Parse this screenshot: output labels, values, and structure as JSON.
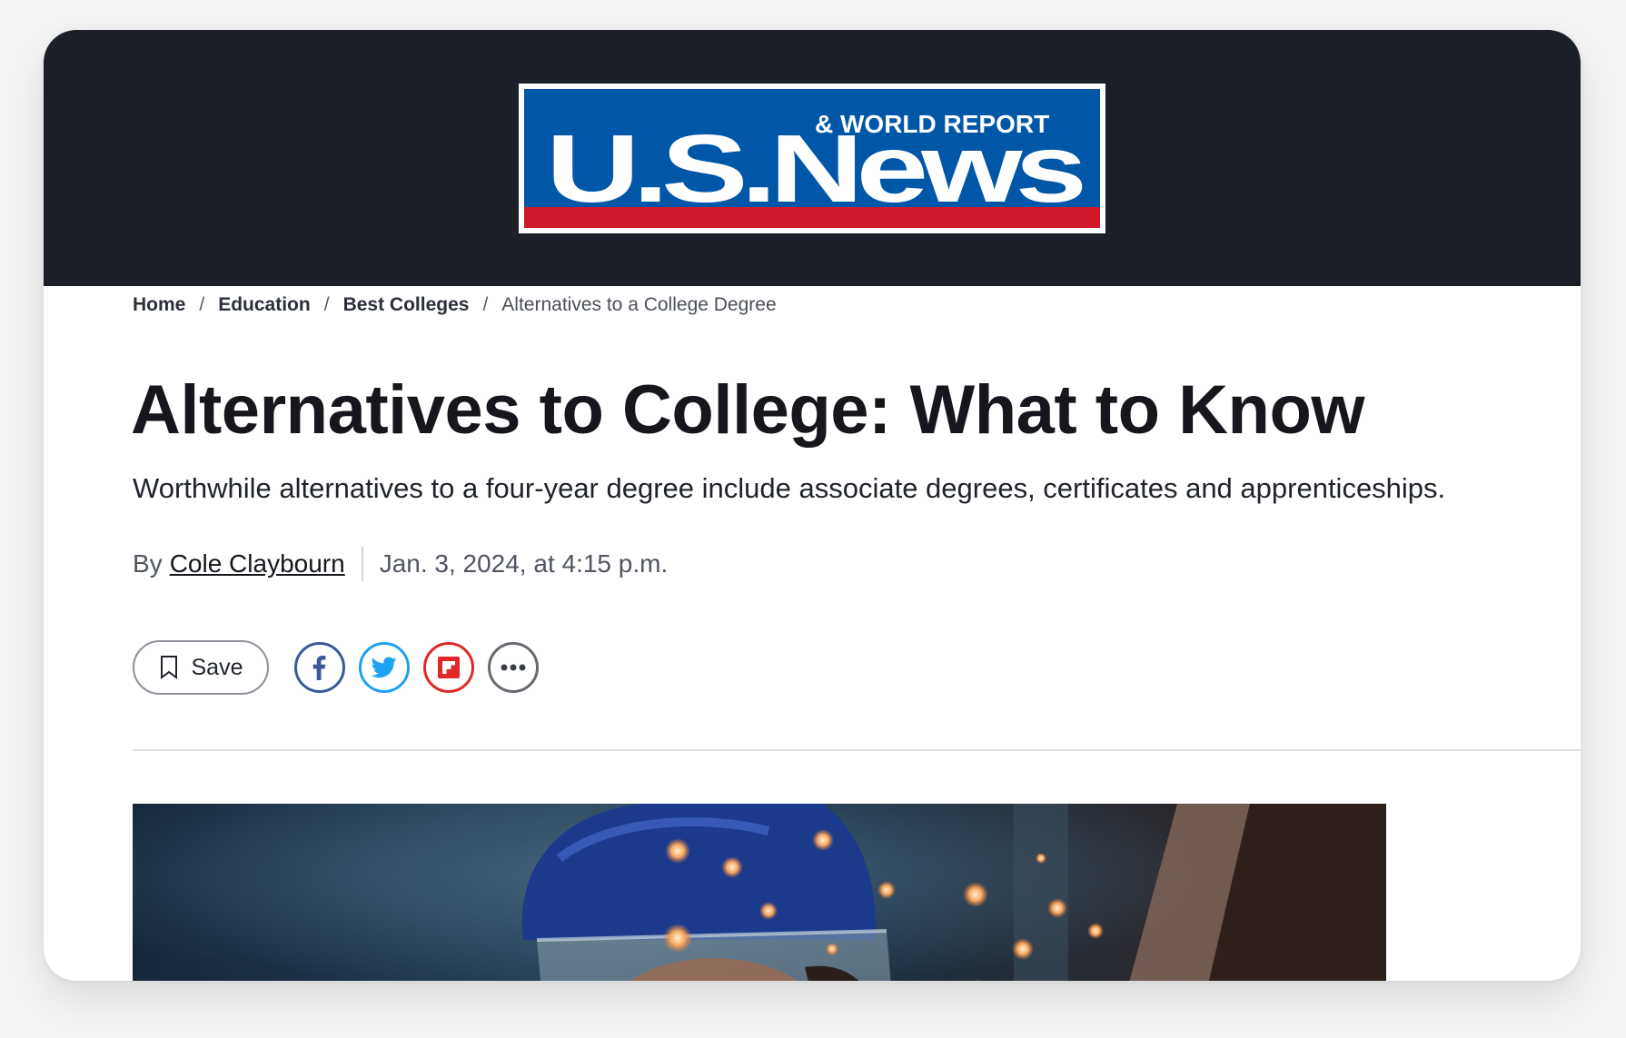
{
  "logo": {
    "brand": "U.S.News",
    "tagline": "& WORLD REPORT",
    "colors": {
      "blue": "#0057a8",
      "red": "#d0192b",
      "white": "#ffffff"
    }
  },
  "breadcrumb": {
    "items": [
      "Home",
      "Education",
      "Best Colleges"
    ],
    "separator": "/",
    "current": "Alternatives to a College Degree"
  },
  "article": {
    "headline": "Alternatives to College: What to Know",
    "dek": "Worthwhile alternatives to a four-year degree include associate degrees, certificates and apprenticeships.",
    "byline_prefix": "By",
    "author": "Cole Claybourn",
    "date": "Jan. 3, 2024, at 4:15 p.m."
  },
  "actions": {
    "save_label": "Save",
    "share_icons": [
      "facebook-icon",
      "twitter-icon",
      "flipboard-icon",
      "more-icon"
    ],
    "share_colors": {
      "facebook": "#3b5998",
      "twitter": "#1da1f2",
      "flipboard": "#e12828",
      "more": "#666a72"
    }
  },
  "hero_image": {
    "subject": "welder-with-face-shield-and-sparks"
  }
}
